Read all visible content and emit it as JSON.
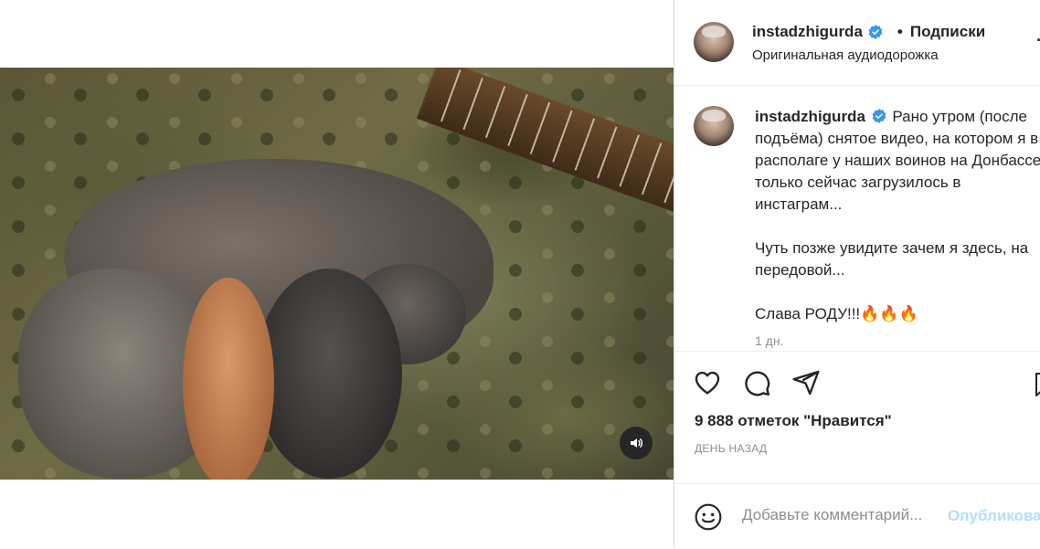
{
  "colors": {
    "verified": "#3897f0",
    "publish": "#b2dffc",
    "muted_text": "#8e8e8e",
    "mute_button": "#262626"
  },
  "media": {
    "mute_icon": "speaker-icon"
  },
  "header": {
    "username": "instadzhigurda",
    "separator": "•",
    "follow_label": "Подписки",
    "audio": "Оригинальная аудиодорожка",
    "more_icon": "more-icon"
  },
  "caption": {
    "username": "instadzhigurda",
    "line1": "Рано утром (после подъёма) снятое видео, на котором я в располаге у наших воинов на Донбассе, только сейчас загрузилось в инстаграм...",
    "line2": "Чуть позже увидите зачем я здесь, на передовой...",
    "line3": "Слава РОДУ!!!🔥🔥🔥",
    "time": "1 дн."
  },
  "actions": {
    "icons": [
      "heart-icon",
      "comment-icon",
      "share-icon",
      "bookmark-icon"
    ],
    "likes": "9 888 отметок \"Нравится\"",
    "posted": "ДЕНЬ НАЗАД"
  },
  "comment": {
    "placeholder": "Добавьте комментарий...",
    "publish_label": "Опубликовать"
  }
}
